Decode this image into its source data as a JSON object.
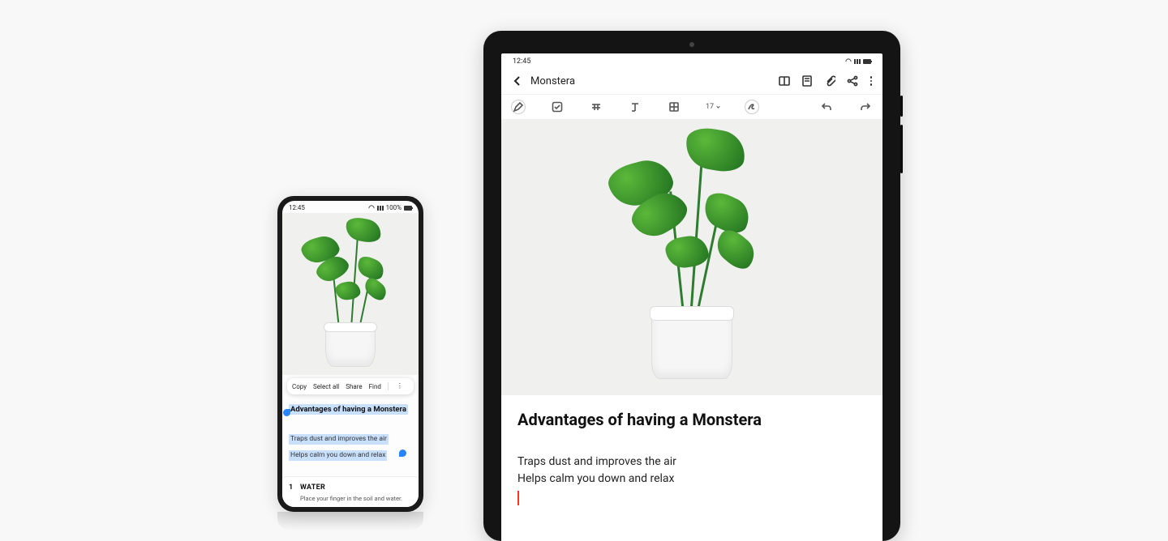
{
  "phone": {
    "status": {
      "time": "12:45",
      "battery": "100%"
    },
    "context_menu": {
      "copy": "Copy",
      "select_all": "Select all",
      "share": "Share",
      "find": "Find"
    },
    "selected": {
      "title": "Advantages of having a Monstera",
      "line1": "Traps dust and improves the air",
      "line2": "Helps calm you down and relax"
    },
    "bottom_card": {
      "number": "1",
      "title": "WATER",
      "desc": "Place your finger in the soil and water."
    }
  },
  "tablet": {
    "status": {
      "time": "12:45"
    },
    "header": {
      "title": "Monstera"
    },
    "toolbar": {
      "font_size": "17"
    },
    "content": {
      "title": "Advantages of having a Monstera",
      "line1": "Traps dust and improves the air",
      "line2": "Helps calm you down and relax"
    }
  }
}
